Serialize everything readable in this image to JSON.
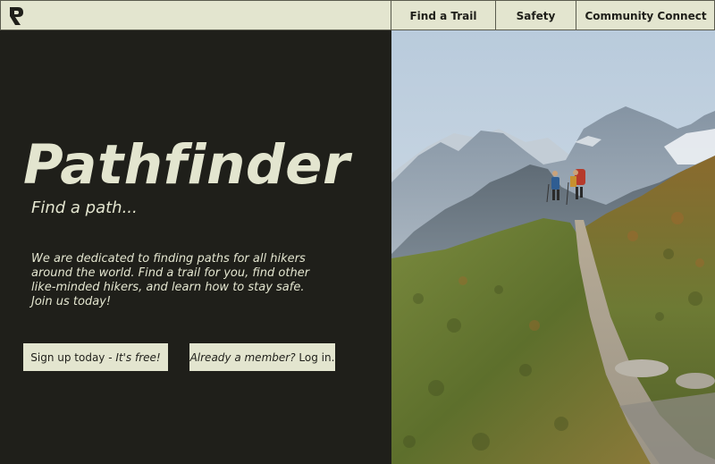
{
  "nav": {
    "items": [
      {
        "label": "Find a Trail"
      },
      {
        "label": "Safety"
      },
      {
        "label": "Community Connect"
      }
    ]
  },
  "hero": {
    "title": "Pathfinder",
    "tagline": "Find a path...",
    "description": "We are dedicated to finding paths for all hikers around the world. Find a trail for you, find other like-minded hikers, and learn how to stay safe. Join us today!"
  },
  "buttons": {
    "signup_main": "Sign up today - ",
    "signup_emphasis": "It's free!",
    "login_emphasis": "Already a member?",
    "login_main": " Log in."
  },
  "colors": {
    "background_dark": "#1f1f1a",
    "accent_cream": "#e3e5cf"
  }
}
